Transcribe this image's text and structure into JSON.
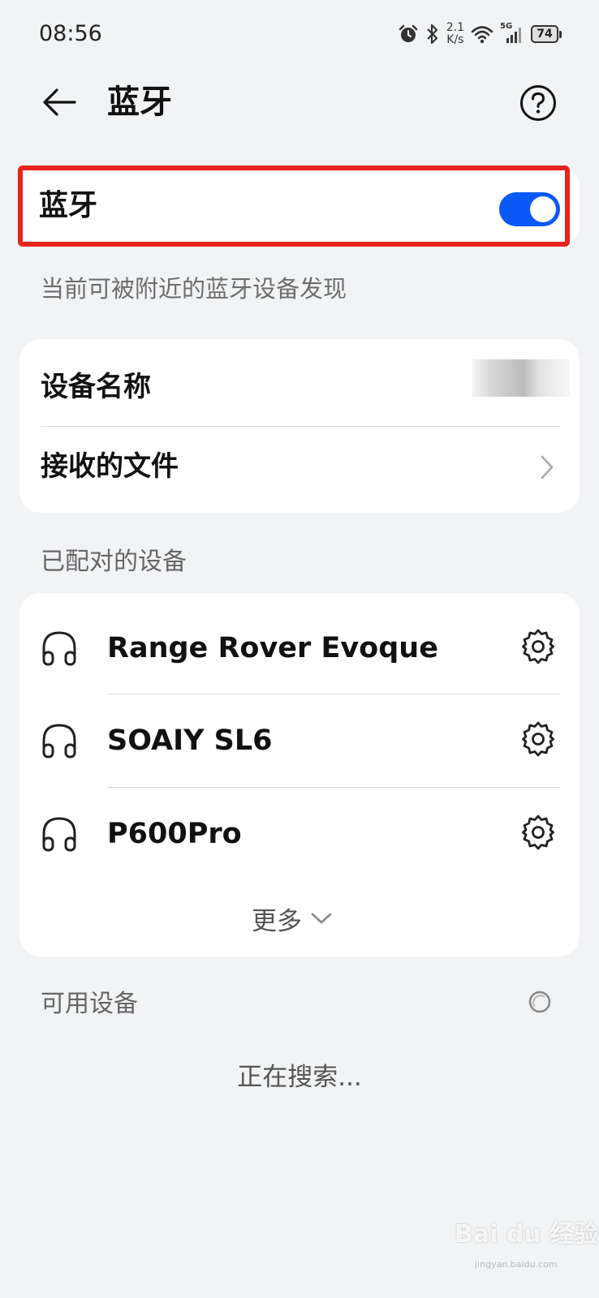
{
  "status_bar": {
    "time": "08:56",
    "net_speed_value": "2.1",
    "net_speed_unit": "K/s",
    "signal_label": "5G",
    "battery": "74",
    "icons": [
      "alarm-icon",
      "bluetooth-icon",
      "wifi-icon",
      "cellular-signal-icon",
      "battery-icon"
    ]
  },
  "header": {
    "title": "蓝牙",
    "back_icon": "back-arrow-icon",
    "help_icon": "help-icon"
  },
  "bluetooth": {
    "label": "蓝牙",
    "enabled": true,
    "accent_color": "#0a59f7",
    "highlight_color": "#e8241b"
  },
  "visibility_hint": "当前可被附近的蓝牙设备发现",
  "device_info": {
    "device_name_label": "设备名称",
    "received_files_label": "接收的文件"
  },
  "paired": {
    "section_title": "已配对的设备",
    "devices": [
      {
        "name": "Range Rover Evoque",
        "icon": "headphones-icon"
      },
      {
        "name": "SOAIY SL6",
        "icon": "headphones-icon"
      },
      {
        "name": "P600Pro",
        "icon": "headphones-icon"
      }
    ],
    "more_label": "更多"
  },
  "available": {
    "section_title": "可用设备",
    "searching_text": "正在搜索..."
  },
  "watermark": {
    "text": "Bai du 经验",
    "sub": "jingyan.baidu.com"
  }
}
